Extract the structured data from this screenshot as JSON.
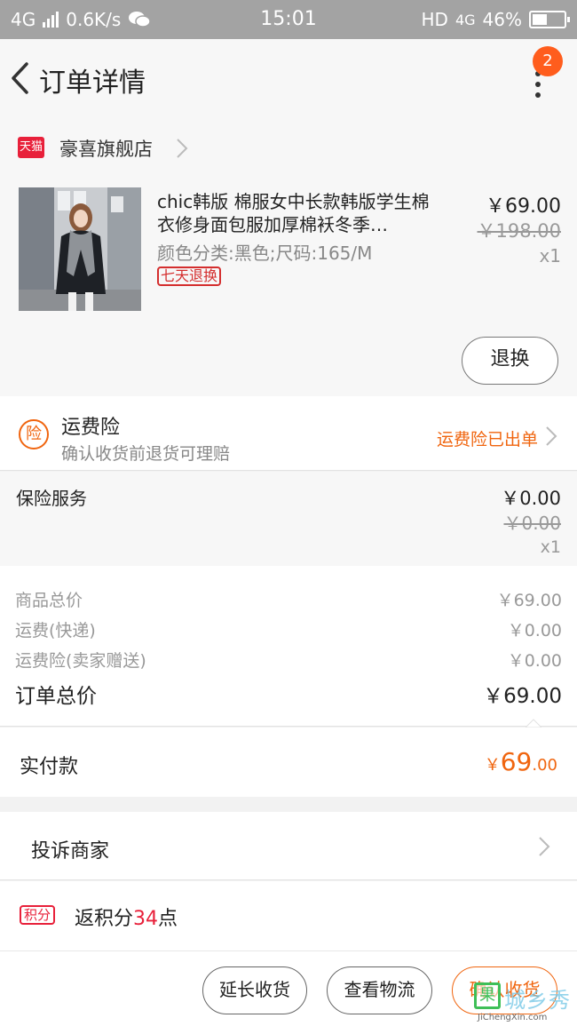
{
  "status_bar": {
    "network": "4G",
    "speed": "0.6K/s",
    "time": "15:01",
    "hd": "HD",
    "net2": "4G",
    "battery": "46%"
  },
  "nav": {
    "title": "订单详情",
    "badge": "2"
  },
  "shop": {
    "logo": "天猫",
    "name": "豪喜旗舰店"
  },
  "product": {
    "title": "chic韩版 棉服女中长款韩版学生棉衣修身面包服加厚棉袄冬季…",
    "attributes": "颜色分类:黑色;尺码:165/M",
    "tag": "七天退换",
    "price": "￥69.00",
    "original_price": "￥198.00",
    "quantity": "x1",
    "return_button": "退换"
  },
  "shipping_insurance": {
    "icon_text": "险",
    "title": "运费险",
    "subtitle": "确认收货前退货可理赔",
    "status": "运费险已出单"
  },
  "insurance_service": {
    "title": "保险服务",
    "price": "￥0.00",
    "original_price": "￥0.00",
    "quantity": "x1"
  },
  "summary": {
    "rows": [
      {
        "label": "商品总价",
        "value": "￥69.00"
      },
      {
        "label": "运费(快递)",
        "value": "￥0.00"
      },
      {
        "label": "运费险(卖家赠送)",
        "value": "￥0.00"
      }
    ],
    "total_label": "订单总价",
    "total_value": "￥69.00"
  },
  "paid": {
    "label": "实付款",
    "currency": "￥",
    "integer": "69",
    "decimal": ".00"
  },
  "complain": {
    "label": "投诉商家"
  },
  "points": {
    "tag": "积分",
    "prefix": "返积分",
    "number": "34",
    "suffix": "点"
  },
  "actions": {
    "extend": "延长收货",
    "logistics": "查看物流",
    "confirm": "确认收货"
  },
  "watermark": {
    "icon": "果",
    "cn": "城乡秀",
    "en": "JiChengXin.com"
  },
  "colors": {
    "accent": "#f0650f",
    "tmall_red": "#e8203a",
    "badge": "#ff5d1d"
  }
}
